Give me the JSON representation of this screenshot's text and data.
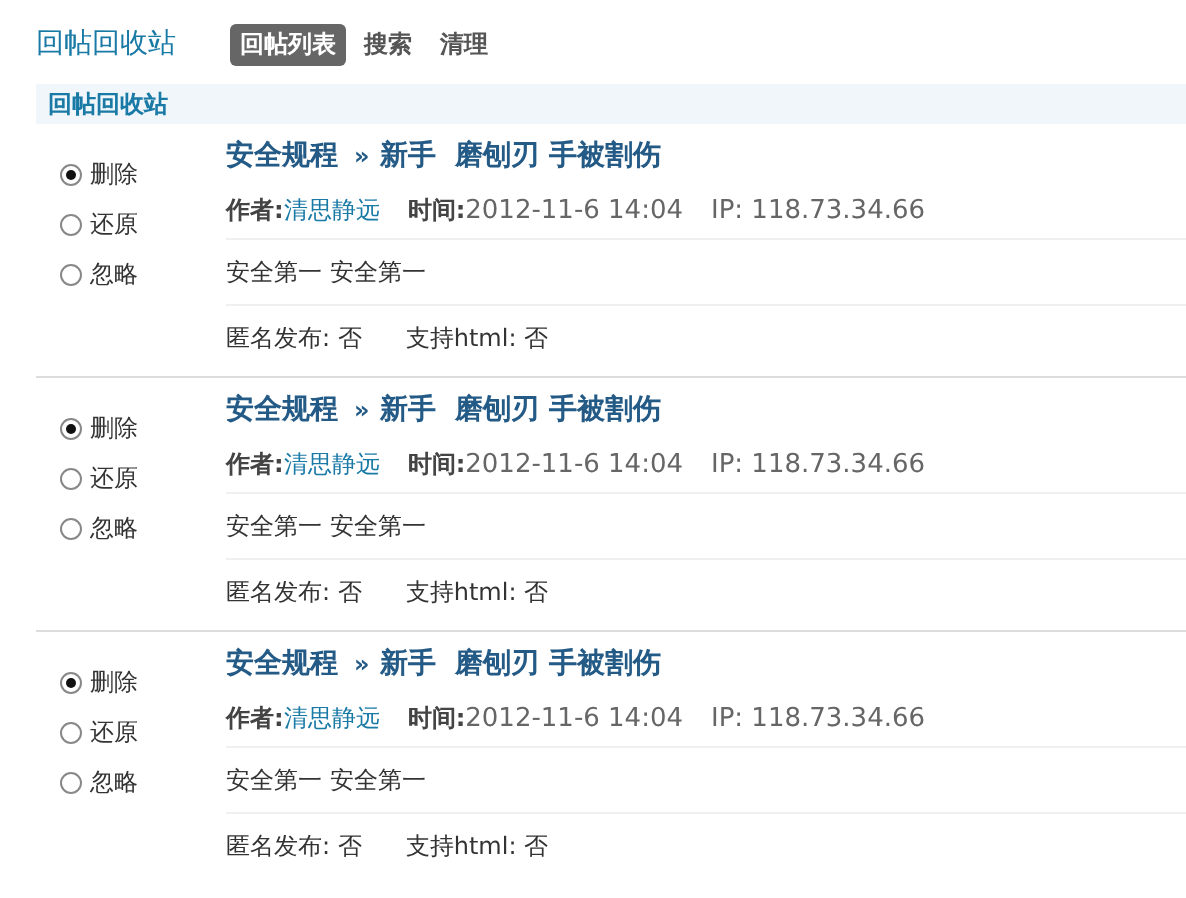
{
  "title": "回帖回收站",
  "tabs": [
    {
      "label": "回帖列表",
      "selected": true
    },
    {
      "label": "搜索",
      "selected": false
    },
    {
      "label": "清理",
      "selected": false
    }
  ],
  "subheader": "回帖回收站",
  "posts": [
    {
      "options": [
        {
          "label": "删除",
          "selected": true
        },
        {
          "label": "还原",
          "selected": false
        },
        {
          "label": "忽略",
          "selected": false
        }
      ],
      "forum": "安全规程",
      "separator": "»",
      "thread": "新手  磨刨刃 手被割伤",
      "author_label": "作者:",
      "author": "清思静远",
      "time_label": "时间:",
      "time": "2012-11-6 14:04",
      "ip": "IP: 118.73.34.66",
      "body": "安全第一 安全第一",
      "anonymous": "匿名发布: 否",
      "html": "支持html: 否"
    },
    {
      "options": [
        {
          "label": "删除",
          "selected": true
        },
        {
          "label": "还原",
          "selected": false
        },
        {
          "label": "忽略",
          "selected": false
        }
      ],
      "forum": "安全规程",
      "separator": "»",
      "thread": "新手  磨刨刃 手被割伤",
      "author_label": "作者:",
      "author": "清思静远",
      "time_label": "时间:",
      "time": "2012-11-6 14:04",
      "ip": "IP: 118.73.34.66",
      "body": "安全第一 安全第一",
      "anonymous": "匿名发布: 否",
      "html": "支持html: 否"
    },
    {
      "options": [
        {
          "label": "删除",
          "selected": true
        },
        {
          "label": "还原",
          "selected": false
        },
        {
          "label": "忽略",
          "selected": false
        }
      ],
      "forum": "安全规程",
      "separator": "»",
      "thread": "新手  磨刨刃 手被割伤",
      "author_label": "作者:",
      "author": "清思静远",
      "time_label": "时间:",
      "time": "2012-11-6 14:04",
      "ip": "IP: 118.73.34.66",
      "body": "安全第一 安全第一",
      "anonymous": "匿名发布: 否",
      "html": "支持html: 否"
    }
  ]
}
